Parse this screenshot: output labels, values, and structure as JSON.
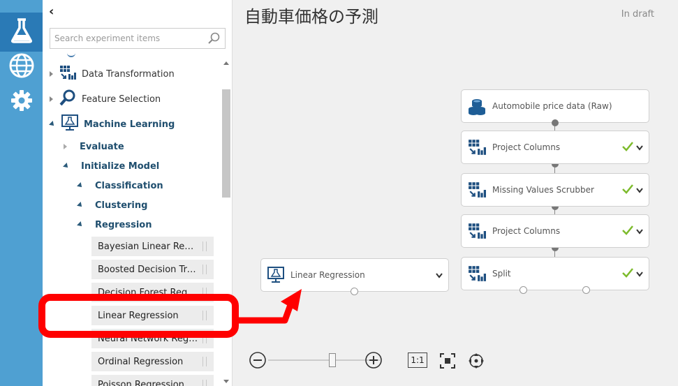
{
  "palette": {
    "collapse_glyph": "‹",
    "search_placeholder": "Search experiment items",
    "categories": [
      {
        "label": "Data Transformation"
      },
      {
        "label": "Feature Selection"
      },
      {
        "label": "Machine Learning"
      }
    ],
    "ml_children": [
      {
        "label": "Evaluate"
      },
      {
        "label": "Initialize Model"
      }
    ],
    "init_children": [
      {
        "label": "Classification"
      },
      {
        "label": "Clustering"
      },
      {
        "label": "Regression"
      }
    ],
    "regression_items": [
      {
        "label": "Bayesian Linear Regression"
      },
      {
        "label": "Boosted Decision Tree Regression"
      },
      {
        "label": "Decision Forest Regression"
      },
      {
        "label": "Linear Regression"
      },
      {
        "label": "Neural Network Regression"
      },
      {
        "label": "Ordinal Regression"
      },
      {
        "label": "Poisson Regression"
      }
    ]
  },
  "canvas": {
    "title": "自動車価格の予測",
    "status": "In draft",
    "modules": [
      {
        "label": "Automobile price data (Raw)",
        "icon": "dataset-icon"
      },
      {
        "label": "Project Columns",
        "icon": "transform-icon"
      },
      {
        "label": "Missing Values Scrubber",
        "icon": "transform-icon"
      },
      {
        "label": "Project Columns",
        "icon": "transform-icon"
      },
      {
        "label": "Split",
        "icon": "transform-icon"
      }
    ],
    "dropped_module": {
      "label": "Linear Regression",
      "icon": "machine-learning-icon"
    },
    "zoom": {
      "one_to_one": "1:1"
    }
  },
  "colors": {
    "rail": "#4fa0d2",
    "rail_active": "#2a7ab6",
    "check": "#7dbb2c",
    "highlight": "#ff0000"
  }
}
